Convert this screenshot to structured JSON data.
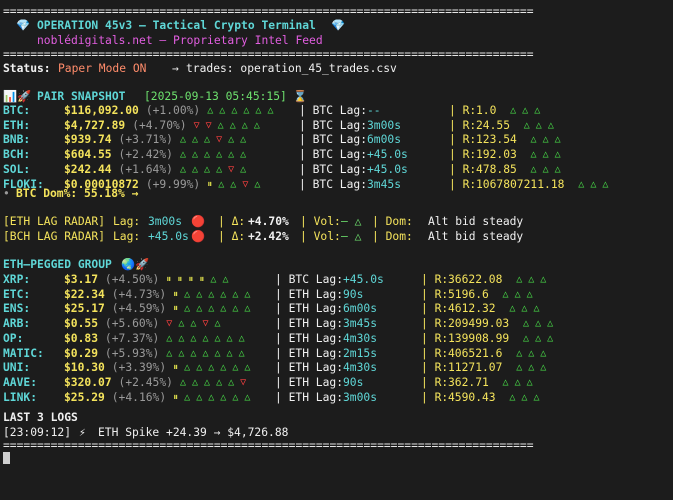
{
  "separator": "==============================================================================",
  "header": {
    "gem_left": "💎",
    "title": "OPERATION 45v3 — Tactical Crypto Terminal",
    "gem_right": "💎",
    "subtitle": "noblédigitals.net — Proprietary Intel Feed"
  },
  "status": {
    "label": "Status:",
    "mode": "Paper Mode ON",
    "arrow": "→",
    "trades": "trades: operation_45_trades.csv"
  },
  "pair_snapshot": {
    "icon": "📊🚀",
    "title": "PAIR SNAPSHOT",
    "timestamp": "[2025-09-13 05:45:15]",
    "hourglass": "⌛",
    "rows": [
      {
        "sym": "BTC:",
        "price": "$116,092.00",
        "pct": "(+1.00%)",
        "trend": "uuuuuu",
        "lag_label": "| BTC Lag:",
        "lag": "--",
        "r_label": "| R:",
        "r": "1.0",
        "rtrend": "uuu"
      },
      {
        "sym": "ETH:",
        "price": "$4,727.89",
        "pct": "(+4.70%)",
        "trend": "dduuuu",
        "lag_label": "| BTC Lag:",
        "lag": "3m00s",
        "r_label": "| R:",
        "r": "24.55",
        "rtrend": "uuu"
      },
      {
        "sym": "BNB:",
        "price": "$939.74",
        "pct": "(+3.71%)",
        "trend": "uuuduu",
        "lag_label": "| BTC Lag:",
        "lag": "6m00s",
        "r_label": "| R:",
        "r": "123.54",
        "rtrend": "uuu"
      },
      {
        "sym": "BCH:",
        "price": "$604.55",
        "pct": "(+2.42%)",
        "trend": "uuuuuu",
        "lag_label": "| BTC Lag:",
        "lag": "+45.0s",
        "r_label": "| R:",
        "r": "192.03",
        "rtrend": "uuu"
      },
      {
        "sym": "SOL:",
        "price": "$242.44",
        "pct": "(+1.64%)",
        "trend": "uuuudu",
        "lag_label": "| BTC Lag:",
        "lag": "+45.0s",
        "r_label": "| R:",
        "r": "478.85",
        "rtrend": "uuu"
      },
      {
        "sym": "FLOKI:",
        "price": "$0.00010872",
        "pct": "(+9.99%)",
        "trend": "puudu",
        "lag_label": "| BTC Lag:",
        "lag": "3m45s",
        "r_label": "| R:",
        "r": "1067807211.18",
        "rtrend": "uuu"
      }
    ],
    "dominance_bullet": "•",
    "dominance": "BTC Dom%: 55.18% →"
  },
  "lag_radar": [
    {
      "tag": "[ETH LAG RADAR]",
      "lag_label": "Lag:",
      "lag": "3m00s",
      "dot": "🔴",
      "delta_label": "| Δ:",
      "delta": "+4.70%",
      "vol_label": "| Vol:",
      "vol": "— △",
      "dom_label": "| Dom:",
      "dom": "Alt bid steady"
    },
    {
      "tag": "[BCH LAG RADAR]",
      "lag_label": "Lag:",
      "lag": "+45.0s",
      "dot": "🔴",
      "delta_label": "| Δ:",
      "delta": "+2.42%",
      "vol_label": "| Vol:",
      "vol": "— △",
      "dom_label": "| Dom:",
      "dom": "Alt bid steady"
    }
  ],
  "eth_group": {
    "title": "ETH—PEGGED GROUP",
    "icon": "🌏🚀",
    "rows": [
      {
        "sym": "XRP:",
        "price": "$3.17",
        "pct": "(+4.50%)",
        "trend": "ppppuu",
        "lag_label": "| BTC Lag:",
        "lag": "+45.0s",
        "r_label": "| R:",
        "r": "36622.08",
        "rtrend": "uuu"
      },
      {
        "sym": "ETC:",
        "price": "$22.34",
        "pct": "(+4.73%)",
        "trend": "puuuuuu",
        "lag_label": "| ETH Lag:",
        "lag": "90s",
        "r_label": "| R:",
        "r": "5196.6",
        "rtrend": "uuu"
      },
      {
        "sym": "ENS:",
        "price": "$25.17",
        "pct": "(+4.59%)",
        "trend": "puuuuuu",
        "lag_label": "| ETH Lag:",
        "lag": "6m00s",
        "r_label": "| R:",
        "r": "4612.32",
        "rtrend": "uuu"
      },
      {
        "sym": "ARB:",
        "price": "$0.55",
        "pct": "(+5.60%)",
        "trend": "duudu",
        "lag_label": "| ETH Lag:",
        "lag": "3m45s",
        "r_label": "| R:",
        "r": "209499.03",
        "rtrend": "uuu"
      },
      {
        "sym": "OP:",
        "price": "$0.83",
        "pct": "(+7.37%)",
        "trend": "uuuuuuu",
        "lag_label": "| ETH Lag:",
        "lag": "4m30s",
        "r_label": "| R:",
        "r": "139908.99",
        "rtrend": "uuu"
      },
      {
        "sym": "MATIC:",
        "price": "$0.29",
        "pct": "(+5.93%)",
        "trend": "uuuuuuu",
        "lag_label": "| ETH Lag:",
        "lag": "2m15s",
        "r_label": "| R:",
        "r": "406521.6",
        "rtrend": "uuu"
      },
      {
        "sym": "UNI:",
        "price": "$10.30",
        "pct": "(+3.39%)",
        "trend": "puuuuuu",
        "lag_label": "| ETH Lag:",
        "lag": "4m30s",
        "r_label": "| R:",
        "r": "11271.07",
        "rtrend": "uuu"
      },
      {
        "sym": "AAVE:",
        "price": "$320.07",
        "pct": "(+2.45%)",
        "trend": "uuuuud",
        "lag_label": "| ETH Lag:",
        "lag": "90s",
        "r_label": "| R:",
        "r": "362.71",
        "rtrend": "uuu"
      },
      {
        "sym": "LINK:",
        "price": "$25.29",
        "pct": "(+4.16%)",
        "trend": "puuuuuu",
        "lag_label": "| ETH Lag:",
        "lag": "3m00s",
        "r_label": "| R:",
        "r": "4590.43",
        "rtrend": "uuu"
      }
    ]
  },
  "logs": {
    "title": "LAST 3 LOGS",
    "time": "[23:09:12]",
    "bolt": "⚡",
    "entry": "ETH Spike +24.39 → $4,726.88"
  },
  "colors": {
    "background": "#1c1c1c",
    "cyan": "#5fd7d7",
    "magenta": "#e25ee0",
    "yellow": "#f4e35c",
    "green": "#6ee26e",
    "red": "#ff4f4f",
    "orange": "#ff8c6b"
  }
}
